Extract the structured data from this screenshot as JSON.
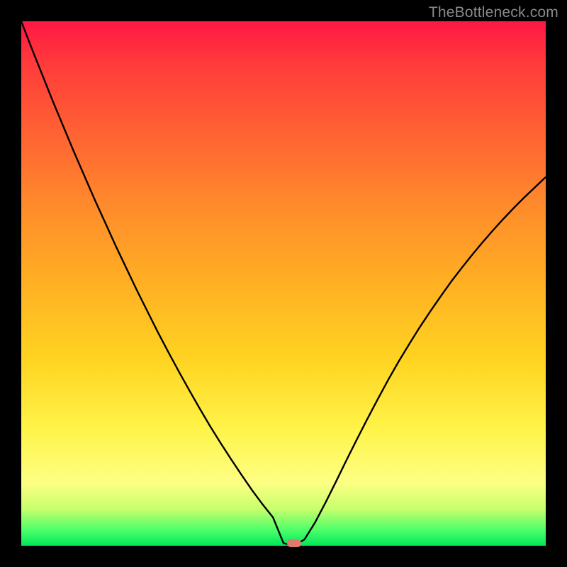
{
  "watermark": {
    "text": "TheBottleneck.com"
  },
  "chart_data": {
    "type": "line",
    "title": "",
    "xlabel": "",
    "ylabel": "",
    "x": [
      0.0,
      0.02,
      0.04,
      0.06,
      0.08,
      0.1,
      0.12,
      0.14,
      0.16,
      0.18,
      0.2,
      0.22,
      0.24,
      0.26,
      0.28,
      0.3,
      0.32,
      0.34,
      0.36,
      0.38,
      0.4,
      0.42,
      0.44,
      0.46,
      0.48,
      0.5,
      0.52,
      0.54,
      0.56,
      0.58,
      0.6,
      0.62,
      0.64,
      0.66,
      0.68,
      0.7,
      0.72,
      0.74,
      0.76,
      0.78,
      0.8,
      0.82,
      0.84,
      0.86,
      0.88,
      0.9,
      0.92,
      0.94,
      0.96,
      0.98,
      1.0
    ],
    "values": [
      1.0,
      0.948,
      0.898,
      0.848,
      0.8,
      0.752,
      0.706,
      0.66,
      0.616,
      0.572,
      0.53,
      0.488,
      0.448,
      0.408,
      0.37,
      0.333,
      0.297,
      0.262,
      0.228,
      0.196,
      0.165,
      0.135,
      0.106,
      0.079,
      0.054,
      0.005,
      0.0,
      0.012,
      0.044,
      0.082,
      0.122,
      0.163,
      0.203,
      0.242,
      0.28,
      0.317,
      0.352,
      0.385,
      0.417,
      0.447,
      0.476,
      0.504,
      0.53,
      0.555,
      0.579,
      0.602,
      0.624,
      0.645,
      0.665,
      0.684,
      0.703
    ],
    "xlim": [
      0,
      1
    ],
    "ylim": [
      0,
      1
    ],
    "min_point": {
      "x_fraction": 0.52,
      "y_fraction": 0.0
    },
    "gradient_stops": [
      {
        "offset": 0.0,
        "color": "#ff1744"
      },
      {
        "offset": 0.5,
        "color": "#ffd522"
      },
      {
        "offset": 0.88,
        "color": "#fdff84"
      },
      {
        "offset": 1.0,
        "color": "#00e65a"
      }
    ]
  }
}
